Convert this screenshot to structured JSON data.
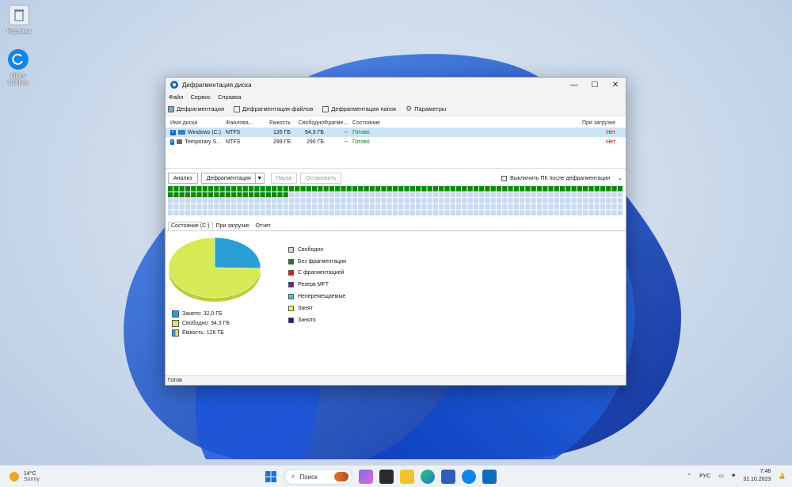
{
  "desktop": {
    "icons": [
      {
        "label": "Корзина",
        "icon": "recycle-bin-icon"
      },
      {
        "label": "Glary Utilities",
        "icon": "glary-utilities-icon"
      }
    ]
  },
  "window": {
    "title": "Дефрагментация диска",
    "controls": {
      "minimize": "—",
      "maximize": "☐",
      "close": "✕"
    },
    "menu": [
      "Файл",
      "Сервис",
      "Справка"
    ],
    "toolbar": [
      {
        "label": "Дефрагментация",
        "icon": "defrag-icon"
      },
      {
        "label": "Дефрагментация файлов",
        "icon": "file-defrag-icon"
      },
      {
        "label": "Дефрагментация папок",
        "icon": "folder-defrag-icon"
      },
      {
        "label": "Параметры",
        "icon": "gear-icon"
      }
    ],
    "drive_table": {
      "columns": [
        "Имя диска",
        "Файловая система",
        "Емкость",
        "Свободно",
        "Фрагментировано",
        "Состояние",
        "При загрузке"
      ],
      "columns_shown": [
        "Имя диска",
        "Файлова...",
        "Емкость",
        "Свободно",
        "Фрагме...",
        "Состояние",
        "При загрузке"
      ],
      "rows": [
        {
          "name": "Windows (C:)",
          "fs": "NTFS",
          "capacity": "126 ГБ",
          "free": "94,3 ГБ",
          "frag": "--",
          "state": "Готово",
          "boot": "Нет",
          "checked": true,
          "selected": true
        },
        {
          "name": "Temporary S...",
          "fs": "NTFS",
          "capacity": "299 ГБ",
          "free": "290 ГБ",
          "frag": "--",
          "state": "Готово",
          "boot": "Нет",
          "checked": true,
          "selected": false
        }
      ]
    },
    "actions": {
      "analyze": "Анализ",
      "defrag": "Дефрагментация",
      "pause": "Пауза",
      "stop": "Остановить",
      "shutdown_label": "Выключить ПК после дефрагментации",
      "shutdown_checked": false
    },
    "cluster_map": {
      "columns": 79,
      "rows": 5,
      "used_fraction": 0.254,
      "colors": {
        "used": "#0b8a0b",
        "free": "#c7daf2"
      }
    },
    "tabs": [
      "Состояние (C:)",
      "При загрузке",
      "Отчет"
    ],
    "active_tab": 0,
    "pie": {
      "slices": [
        {
          "label": "Занято",
          "value": 32.0,
          "color": "#2a9fd6"
        },
        {
          "label": "Свободно",
          "value": 94.3,
          "color": "#d5ea55"
        }
      ],
      "legend": [
        {
          "text": "Занято: 32,0 ГБ",
          "color": "#2a9fd6"
        },
        {
          "text": "Свободно: 94,3 ГБ",
          "color": "#d5ea55"
        },
        {
          "text": "Емкость: 126 ГБ",
          "color": "#8cc7e8"
        }
      ]
    },
    "map_legend": [
      {
        "label": "Свободно",
        "color": "#c7daf2"
      },
      {
        "label": "Без фрагментации",
        "color": "#0b8a0b"
      },
      {
        "label": "С фрагментацией",
        "color": "#e01b1b"
      },
      {
        "label": "Резерв MFT",
        "color": "#7a1f8f"
      },
      {
        "label": "Неперемещаемые",
        "color": "#2bd4d4"
      },
      {
        "label": "Занят",
        "color": "#f2f23a"
      },
      {
        "label": "Занято",
        "color": "#1a1ab0"
      }
    ],
    "status": "Готов"
  },
  "taskbar": {
    "weather": {
      "temp": "14°C",
      "condition": "Sunny"
    },
    "search_placeholder": "Поиск",
    "lang": "РУС",
    "time": "7:46",
    "date": "31.10.2023"
  }
}
